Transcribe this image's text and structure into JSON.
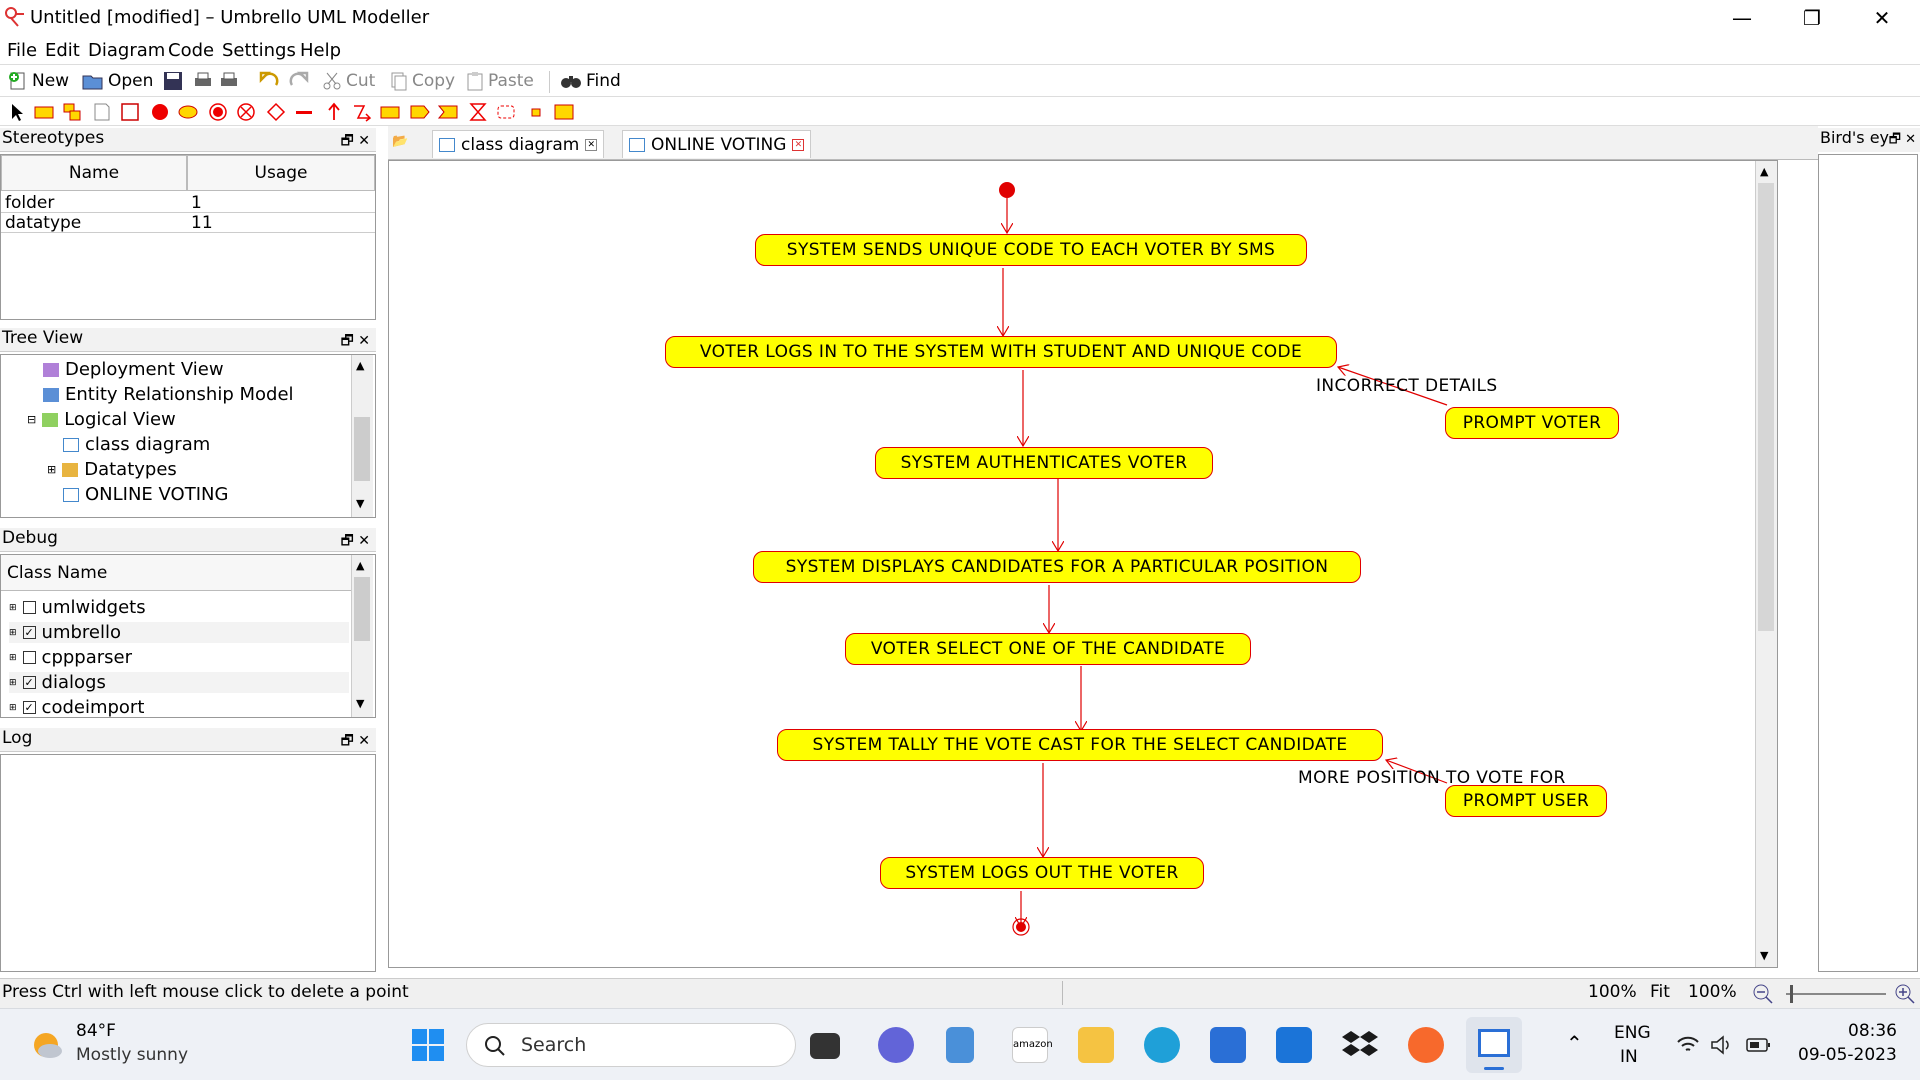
{
  "window": {
    "title": "Untitled [modified] – Umbrello UML Modeller",
    "minimize": "—",
    "maximize": "❐",
    "close": "✕"
  },
  "menu": [
    "File",
    "Edit",
    "Diagram",
    "Code",
    "Settings",
    "Help"
  ],
  "toolbar": {
    "new": "New",
    "open": "Open",
    "cut": "Cut",
    "copy": "Copy",
    "paste": "Paste",
    "find": "Find"
  },
  "stereotypes": {
    "title": "Stereotypes",
    "columns": [
      "Name",
      "Usage"
    ],
    "rows": [
      {
        "name": "folder",
        "usage": "1"
      },
      {
        "name": "datatype",
        "usage": "11"
      }
    ]
  },
  "tree_view": {
    "title": "Tree View",
    "items": [
      "Deployment View",
      "Entity Relationship Model",
      "Logical View",
      "class diagram",
      "Datatypes",
      "ONLINE VOTING"
    ]
  },
  "debug": {
    "title": "Debug",
    "column": "Class Name",
    "items": [
      {
        "name": "umlwidgets",
        "checked": false
      },
      {
        "name": "umbrello",
        "checked": true
      },
      {
        "name": "cppparser",
        "checked": false
      },
      {
        "name": "dialogs",
        "checked": true
      },
      {
        "name": "codeimport",
        "checked": true
      }
    ]
  },
  "log": {
    "title": "Log"
  },
  "birds_eye": {
    "title": "Bird's ey"
  },
  "tabs": [
    "class diagram",
    "ONLINE VOTING"
  ],
  "diagram": {
    "activities": [
      "SYSTEM SENDS UNIQUE CODE TO EACH VOTER BY SMS",
      "VOTER LOGS IN TO THE SYSTEM WITH STUDENT AND UNIQUE CODE",
      "SYSTEM AUTHENTICATES VOTER",
      "SYSTEM DISPLAYS CANDIDATES FOR A PARTICULAR POSITION",
      "VOTER SELECT ONE OF THE CANDIDATE",
      "SYSTEM TALLY THE VOTE CAST FOR THE SELECT CANDIDATE",
      "SYSTEM LOGS OUT THE VOTER",
      "PROMPT VOTER",
      "PROMPT USER"
    ],
    "guards": [
      "INCORRECT DETAILS",
      "MORE POSITION TO VOTE FOR"
    ]
  },
  "status": {
    "message": "Press Ctrl with left mouse click to delete a point",
    "zoom": "100%",
    "fit": "Fit",
    "zoom2": "100%"
  },
  "taskbar": {
    "weather_temp": "84°F",
    "weather_desc": "Mostly sunny",
    "search": "Search",
    "lang1": "ENG",
    "lang2": "IN",
    "time": "08:36",
    "date": "09-05-2023"
  }
}
